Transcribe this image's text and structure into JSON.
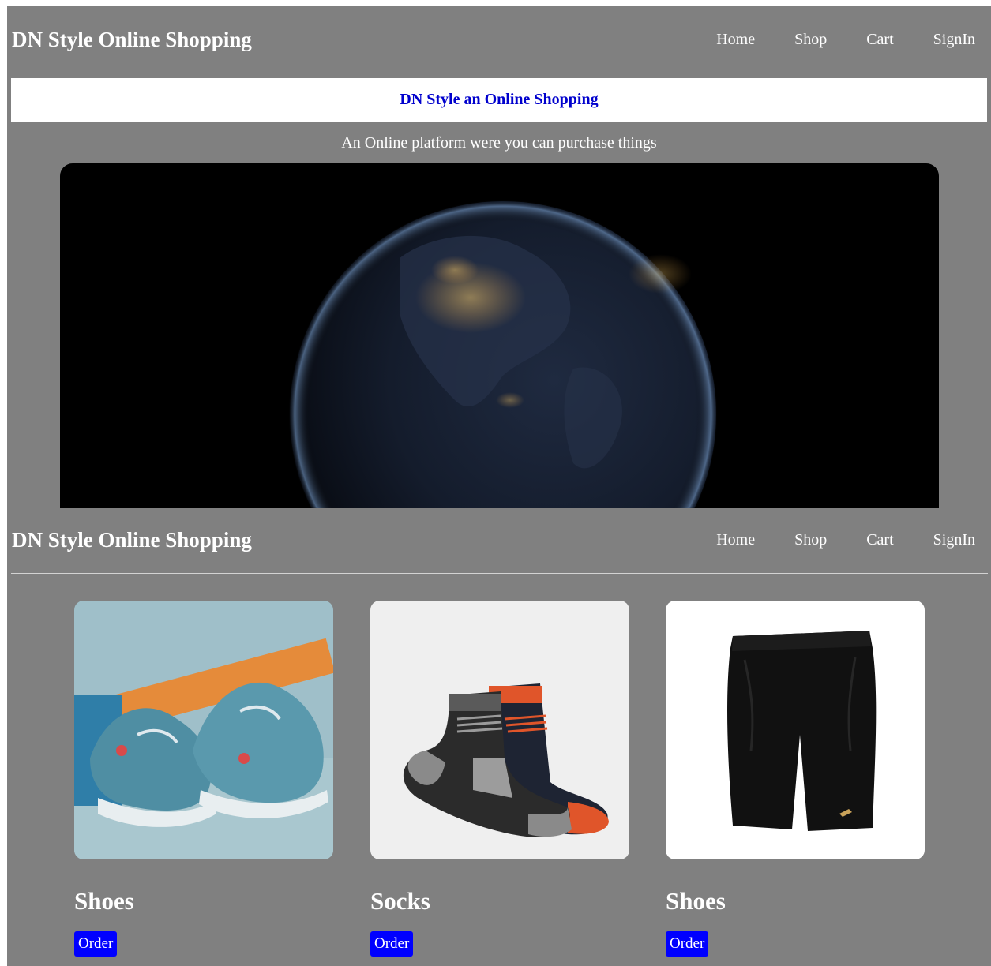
{
  "header": {
    "brand": "DN Style Online Shopping",
    "nav": [
      "Home",
      "Shop",
      "Cart",
      "SignIn"
    ]
  },
  "banner": {
    "title": "DN Style an Online Shopping",
    "tagline": "An Online platform were you can purchase things"
  },
  "products": [
    {
      "name": "Shoes",
      "button": "Order",
      "image": "sneakers-photo"
    },
    {
      "name": "Socks",
      "button": "Order",
      "image": "socks-photo"
    },
    {
      "name": "Shoes",
      "button": "Order",
      "image": "black-shorts-photo"
    }
  ],
  "colors": {
    "page_background": "#808080",
    "banner_text": "#0000cd",
    "order_button": "#0000ff",
    "text": "#ffffff"
  }
}
